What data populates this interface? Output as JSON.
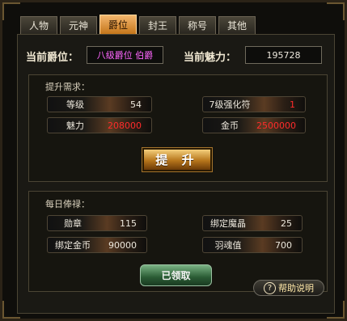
{
  "tabs": [
    {
      "label": "人物",
      "active": false
    },
    {
      "label": "元神",
      "active": false
    },
    {
      "label": "爵位",
      "active": true
    },
    {
      "label": "封王",
      "active": false
    },
    {
      "label": "称号",
      "active": false
    },
    {
      "label": "其他",
      "active": false
    }
  ],
  "header": {
    "current_title_label": "当前爵位：",
    "current_title_value": "八级爵位 伯爵",
    "current_charm_label": "当前魅力：",
    "current_charm_value": "195728"
  },
  "upgrade": {
    "section_title": "提升需求：",
    "requirements": [
      {
        "label": "等级",
        "value": "54",
        "value_color": "#ece7dc"
      },
      {
        "label": "7级强化符",
        "value": "1",
        "value_color": "#ff2b2b"
      },
      {
        "label": "魅力",
        "value": "208000",
        "value_color": "#ff2b2b"
      },
      {
        "label": "金币",
        "value": "2500000",
        "value_color": "#ff2b2b"
      }
    ],
    "button_label": "提 升"
  },
  "daily": {
    "section_title": "每日俸禄：",
    "rewards": [
      {
        "label": "勋章",
        "value": "115"
      },
      {
        "label": "绑定魔晶",
        "value": "25"
      },
      {
        "label": "绑定金币",
        "value": "90000"
      },
      {
        "label": "羽魂值",
        "value": "700"
      }
    ],
    "claim_button_label": "已领取"
  },
  "help": {
    "label": "帮助说明",
    "icon": "question-icon"
  },
  "colors": {
    "active_tab": "#d98b2b",
    "title_text": "#ff66ff",
    "insufficient": "#ff2b2b",
    "claim_button": "#2a5b34",
    "upgrade_button": "#b6751b"
  }
}
